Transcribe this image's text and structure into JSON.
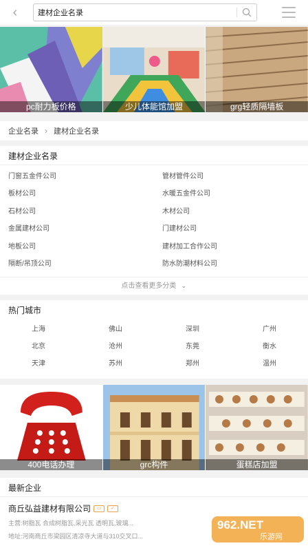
{
  "search": {
    "value": "建材企业名录"
  },
  "top_banner": [
    {
      "caption": "pc耐力板价格"
    },
    {
      "caption": "少儿体能馆加盟"
    },
    {
      "caption": "grg轻质隔墙板"
    }
  ],
  "breadcrumb": {
    "home": "企业名录",
    "current": "建材企业名录"
  },
  "categories": {
    "title": "建材企业名录",
    "items": [
      "门窗五金件公司",
      "管材管件公司",
      "板材公司",
      "水暖五金件公司",
      "石材公司",
      "木材公司",
      "金属建材公司",
      "门建材公司",
      "地板公司",
      "建材加工合作公司",
      "隔断/吊顶公司",
      "防水防潮材料公司"
    ],
    "more": "点击查看更多分类"
  },
  "cities": {
    "title": "热门城市",
    "items": [
      "上海",
      "佛山",
      "深圳",
      "广州",
      "北京",
      "沧州",
      "东莞",
      "衡水",
      "天津",
      "苏州",
      "郑州",
      "温州"
    ]
  },
  "bottom_banner": [
    {
      "caption": "400电话办理"
    },
    {
      "caption": "grc构件"
    },
    {
      "caption": "蛋糕店加盟"
    }
  ],
  "newest": {
    "title": "最新企业",
    "company_name": "商丘弘益建材有限公司",
    "main": "主营:树脂瓦 合成树脂瓦,采光瓦 透明瓦,玻璃...",
    "address": "地址:河南商丘市梁园区清凉寺大道与310交叉口..."
  },
  "watermark": {
    "brand": "962.NET",
    "sub": "乐游网"
  }
}
